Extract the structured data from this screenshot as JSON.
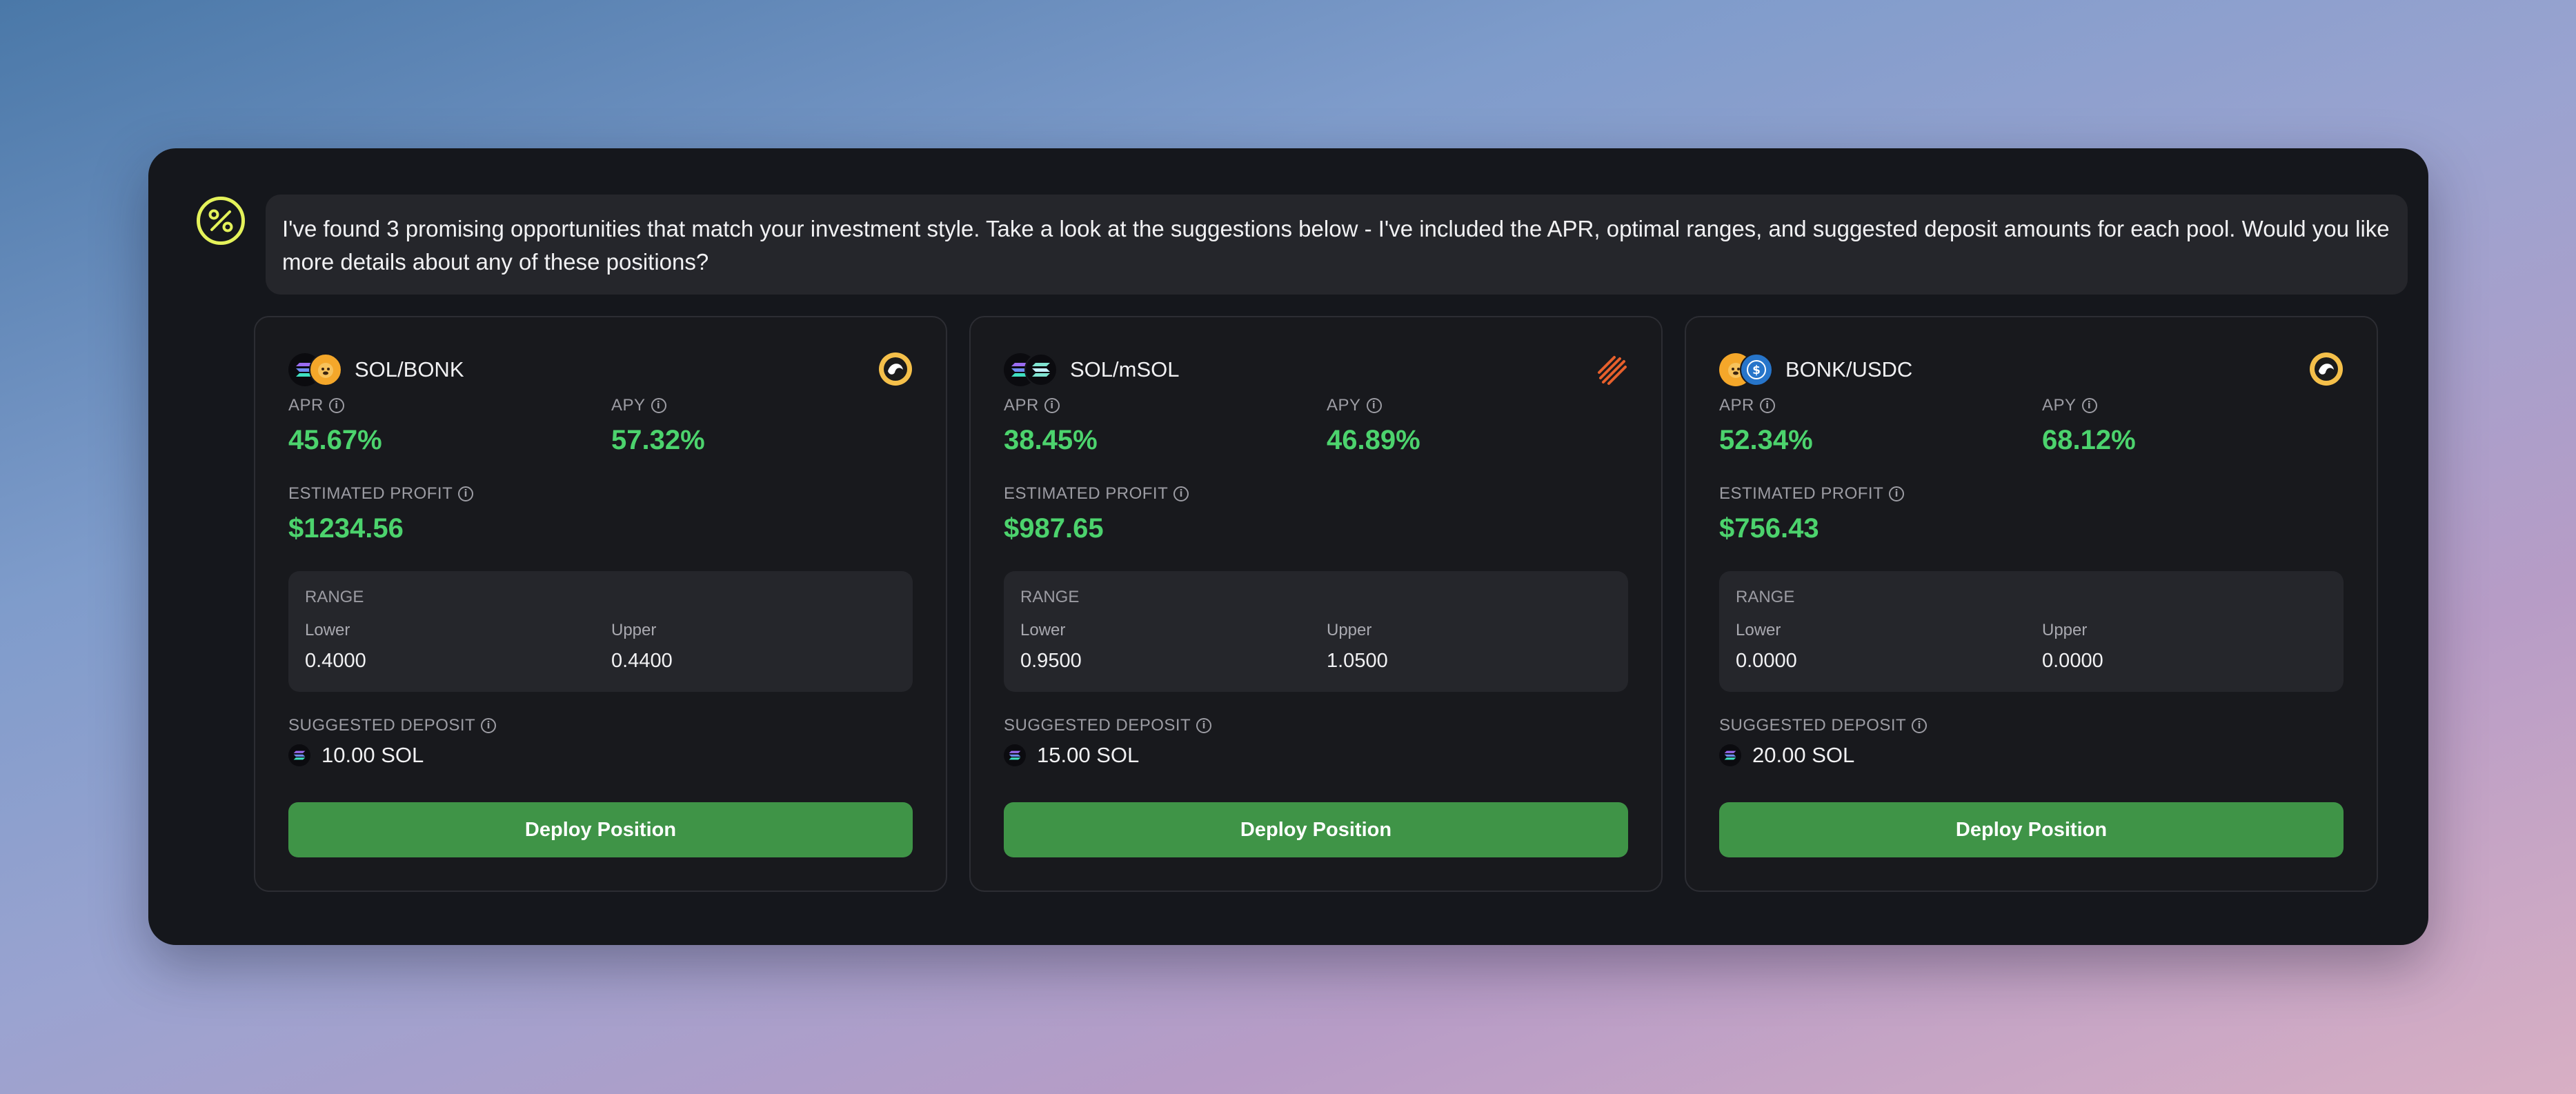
{
  "message": {
    "text": "I've found 3 promising opportunities that match your investment style. Take a look at the suggestions below - I've included the APR, optimal ranges, and suggested deposit amounts for each pool. Would you like more details about any of these positions?"
  },
  "labels": {
    "apr": "APR",
    "apy": "APY",
    "estimated_profit": "ESTIMATED PROFIT",
    "range": "RANGE",
    "lower": "Lower",
    "upper": "Upper",
    "suggested_deposit": "SUGGESTED DEPOSIT",
    "deploy_button": "Deploy Position"
  },
  "pools": [
    {
      "pair": "SOL/BONK",
      "token_icons": [
        "solana-icon",
        "bonk-icon"
      ],
      "protocol_icon": "orca-icon",
      "apr": "45.67%",
      "apy": "57.32%",
      "estimated_profit": "$1234.56",
      "range_lower": "0.4000",
      "range_upper": "0.4400",
      "deposit": "10.00 SOL"
    },
    {
      "pair": "SOL/mSOL",
      "token_icons": [
        "solana-icon",
        "msol-icon"
      ],
      "protocol_icon": "raydium-icon",
      "apr": "38.45%",
      "apy": "46.89%",
      "estimated_profit": "$987.65",
      "range_lower": "0.9500",
      "range_upper": "1.0500",
      "deposit": "15.00 SOL"
    },
    {
      "pair": "BONK/USDC",
      "token_icons": [
        "bonk-icon",
        "usdc-icon"
      ],
      "protocol_icon": "orca-icon",
      "apr": "52.34%",
      "apy": "68.12%",
      "estimated_profit": "$756.43",
      "range_lower": "0.0000",
      "range_upper": "0.0000",
      "deposit": "20.00 SOL"
    }
  ],
  "colors": {
    "accent_green": "#4cd36d",
    "button_green": "#3f9447",
    "avatar_yellow": "#e4f25a",
    "panel_bg": "#15171c"
  }
}
